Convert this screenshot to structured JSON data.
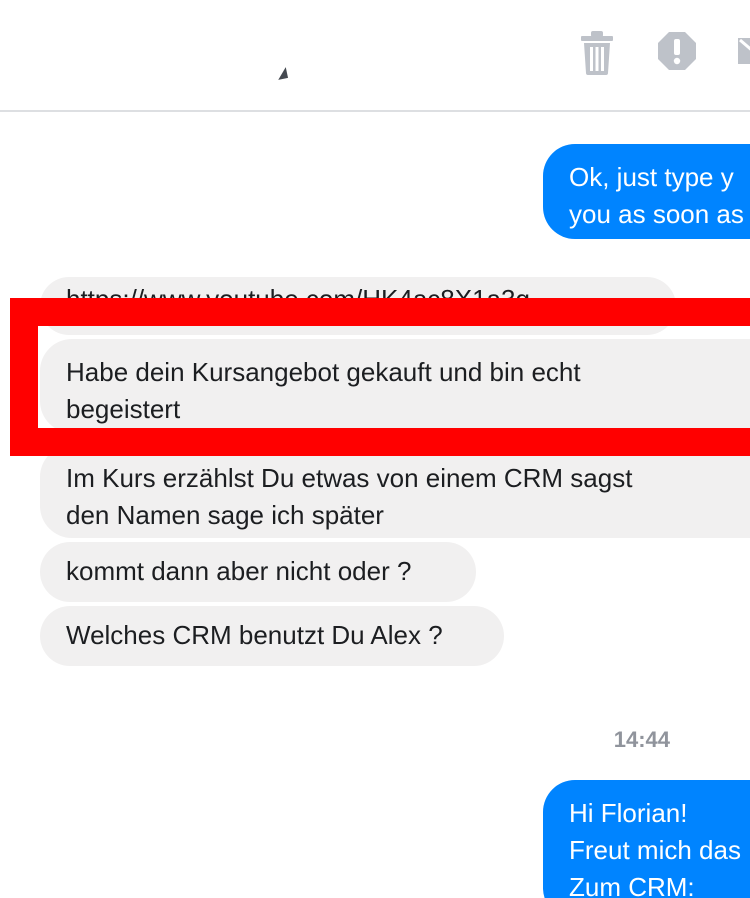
{
  "toolbar": {
    "icons": [
      "trash-icon",
      "alert-icon",
      "mail-icon"
    ]
  },
  "thread": {
    "outgoing_1": [
      "Ok, just type y",
      "you as soon as"
    ],
    "link_message": "https://www.youtube.com/HK4ac8X1a3g",
    "messages": [
      {
        "lines": [
          "Habe dein Kursangebot gekauft und bin echt",
          "begeistert"
        ]
      },
      {
        "lines": [
          "Im Kurs erzählst Du etwas von einem CRM sagst",
          "den Namen sage ich später"
        ]
      },
      {
        "lines": [
          "kommt dann aber nicht oder ?"
        ]
      },
      {
        "lines": [
          "Welches CRM benutzt Du Alex ?"
        ]
      }
    ],
    "timestamp": "14:44",
    "outgoing_2": [
      "Hi Florian!",
      "Freut mich das",
      "Zum CRM:"
    ]
  },
  "colors": {
    "outgoing_bubble": "#0084ff",
    "incoming_bubble": "#f1f0f0",
    "highlight": "#ff0000",
    "timestamp": "#90949c"
  }
}
